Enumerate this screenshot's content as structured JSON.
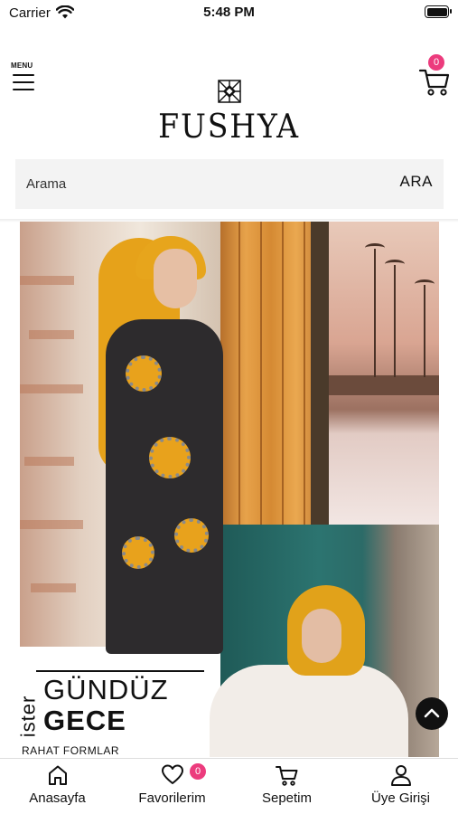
{
  "status_bar": {
    "carrier": "Carrier",
    "time": "5:48 PM"
  },
  "header": {
    "menu_label": "MENU",
    "logo_text": "FUSHYA",
    "cart_count": "0"
  },
  "search": {
    "placeholder": "Arama",
    "button_label": "ARA"
  },
  "banner": {
    "tagline_vertical": "ister",
    "tagline_line1": "GÜNDÜZ",
    "tagline_line2": "GECE",
    "subtitle": "RAHAT FORMLAR"
  },
  "tabbar": {
    "items": [
      {
        "label": "Anasayfa",
        "icon": "home-icon"
      },
      {
        "label": "Favorilerim",
        "icon": "heart-icon",
        "badge": "0"
      },
      {
        "label": "Sepetim",
        "icon": "cart-icon"
      },
      {
        "label": "Üye Girişi",
        "icon": "user-icon"
      }
    ]
  },
  "colors": {
    "badge": "#ec3b7d",
    "search_bg": "#f3f3f3",
    "scroll_top_button": "#111111"
  }
}
